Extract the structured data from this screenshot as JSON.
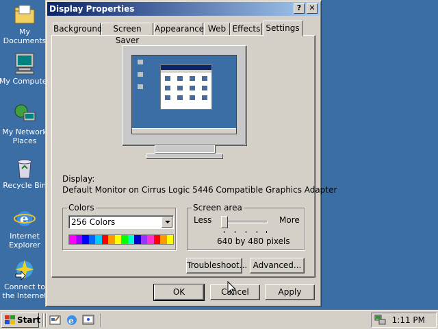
{
  "desktop": {
    "icons": [
      {
        "label": "My Documents",
        "icon": "folder-documents-icon"
      },
      {
        "label": "My Computer",
        "icon": "computer-icon"
      },
      {
        "label": "My Network\nPlaces",
        "icon": "network-icon"
      },
      {
        "label": "Recycle Bin",
        "icon": "recycle-bin-icon"
      },
      {
        "label": "Internet\nExplorer",
        "icon": "ie-icon"
      },
      {
        "label": "Connect to\nthe Internet",
        "icon": "connect-icon"
      }
    ]
  },
  "dialog": {
    "title": "Display Properties",
    "help_button": "?",
    "close_button": "✕",
    "tabs": [
      {
        "label": "Background"
      },
      {
        "label": "Screen Saver"
      },
      {
        "label": "Appearance"
      },
      {
        "label": "Web"
      },
      {
        "label": "Effects"
      },
      {
        "label": "Settings",
        "active": true
      }
    ],
    "display_label": "Display:",
    "display_value": "Default Monitor on Cirrus Logic 5446 Compatible Graphics Adapter",
    "colors": {
      "legend": "Colors",
      "selected": "256 Colors",
      "palette": [
        "#ff00ff",
        "#9900ff",
        "#0000ff",
        "#0066ff",
        "#00ccff",
        "#ff0000",
        "#ff9900",
        "#ffff00",
        "#00ff00",
        "#00ffcc",
        "#0000cc",
        "#9933ff",
        "#ff33cc",
        "#ff0000",
        "#ff9900",
        "#ffff00"
      ]
    },
    "screen_area": {
      "legend": "Screen area",
      "less": "Less",
      "more": "More",
      "value_text": "640 by 480 pixels",
      "slider_fraction": 0.0
    },
    "buttons": {
      "troubleshoot": "Troubleshoot...",
      "advanced": "Advanced...",
      "ok": "OK",
      "cancel": "Cancel",
      "apply": "Apply"
    }
  },
  "taskbar": {
    "start_label": "Start",
    "quick_launch": [
      "desktop-icon",
      "ie-icon",
      "channels-icon"
    ],
    "clock": "1:11 PM"
  },
  "colors": {
    "desktop": "#3a6ea5",
    "titlebar_start": "#0a246a",
    "titlebar_end": "#a6caf0",
    "face": "#d4d0c8"
  }
}
